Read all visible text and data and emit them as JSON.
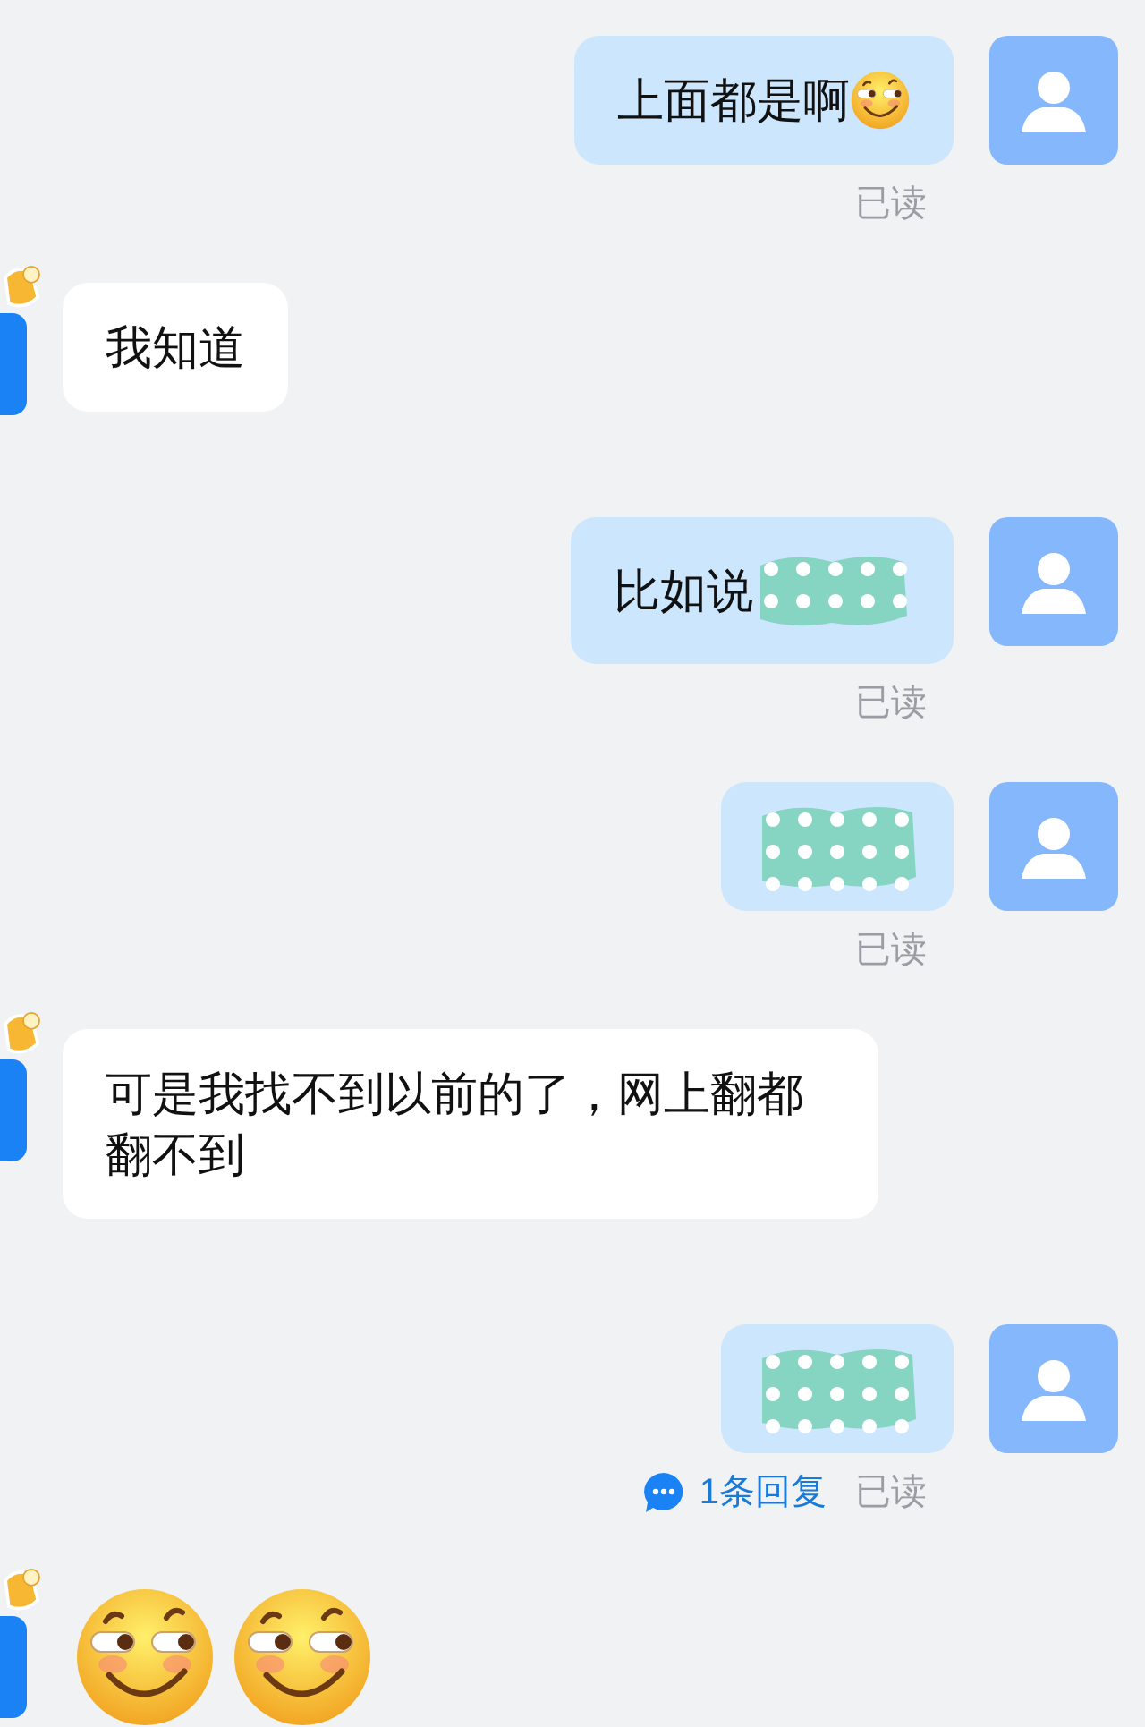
{
  "messages": [
    {
      "kind": "sent",
      "parts": [
        {
          "kind": "text",
          "text": "上面都是啊"
        },
        {
          "kind": "emoji"
        }
      ],
      "status": "已读"
    },
    {
      "kind": "received",
      "parts": [
        {
          "kind": "text",
          "text": "我知道"
        }
      ]
    },
    {
      "kind": "sent",
      "parts": [
        {
          "kind": "text",
          "text": "比如说"
        },
        {
          "kind": "redacted"
        }
      ],
      "status": "已读"
    },
    {
      "kind": "sent",
      "parts": [
        {
          "kind": "redacted"
        }
      ],
      "status": "已读"
    },
    {
      "kind": "received",
      "parts": [
        {
          "kind": "text",
          "text": "可是我找不到以前的了，网上翻都翻不到"
        }
      ]
    },
    {
      "kind": "sent",
      "parts": [
        {
          "kind": "redacted"
        }
      ],
      "reply_count": "1条回复",
      "status": "已读"
    },
    {
      "kind": "received",
      "parts": [
        {
          "kind": "emoji"
        },
        {
          "kind": "emoji"
        }
      ]
    }
  ]
}
